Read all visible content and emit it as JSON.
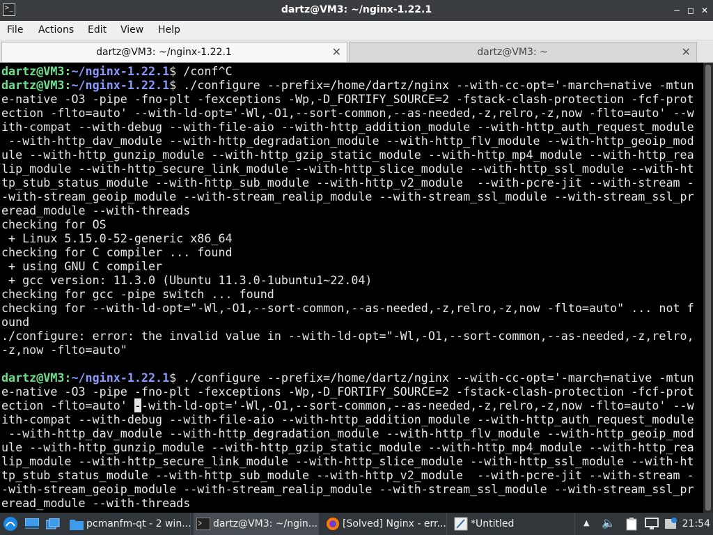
{
  "window": {
    "title": "dartz@VM3: ~/nginx-1.22.1",
    "controls": {
      "minimize": "−",
      "maximize": "◻",
      "close": "✕"
    }
  },
  "menu": [
    "File",
    "Actions",
    "Edit",
    "View",
    "Help"
  ],
  "tabs": [
    {
      "label": "dartz@VM3: ~/nginx-1.22.1",
      "active": true,
      "close": "✕"
    },
    {
      "label": "dartz@VM3: ~",
      "active": false,
      "close": "✕"
    }
  ],
  "terminal": {
    "prompt_user": "dartz@VM3",
    "prompt_path": "~/nginx-1.22.1",
    "lines": [
      {
        "type": "prompt",
        "text": " /conf^C"
      },
      {
        "type": "prompt",
        "text": " ./configure --prefix=/home/dartz/nginx --with-cc-opt='-march=native -mtun"
      },
      {
        "type": "text",
        "text": "e-native -O3 -pipe -fno-plt -fexceptions -Wp,-D_FORTIFY_SOURCE=2 -fstack-clash-protection -fcf-prot"
      },
      {
        "type": "text",
        "text": "ection -flto=auto' --with-ld-opt='-Wl,-O1,--sort-common,--as-needed,-z,relro,-z,now -flto=auto' --w"
      },
      {
        "type": "text",
        "text": "ith-compat --with-debug --with-file-aio --with-http_addition_module --with-http_auth_request_module"
      },
      {
        "type": "text",
        "text": " --with-http_dav_module --with-http_degradation_module --with-http_flv_module --with-http_geoip_mod"
      },
      {
        "type": "text",
        "text": "ule --with-http_gunzip_module --with-http_gzip_static_module --with-http_mp4_module --with-http_rea"
      },
      {
        "type": "text",
        "text": "lip_module --with-http_secure_link_module --with-http_slice_module --with-http_ssl_module --with-ht"
      },
      {
        "type": "text",
        "text": "tp_stub_status_module --with-http_sub_module --with-http_v2_module  --with-pcre-jit --with-stream -"
      },
      {
        "type": "text",
        "text": "-with-stream_geoip_module --with-stream_realip_module --with-stream_ssl_module --with-stream_ssl_pr"
      },
      {
        "type": "text",
        "text": "eread_module --with-threads"
      },
      {
        "type": "text",
        "text": "checking for OS"
      },
      {
        "type": "text",
        "text": " + Linux 5.15.0-52-generic x86_64"
      },
      {
        "type": "text",
        "text": "checking for C compiler ... found"
      },
      {
        "type": "text",
        "text": " + using GNU C compiler"
      },
      {
        "type": "text",
        "text": " + gcc version: 11.3.0 (Ubuntu 11.3.0-1ubuntu1~22.04)"
      },
      {
        "type": "text",
        "text": "checking for gcc -pipe switch ... found"
      },
      {
        "type": "text",
        "text": "checking for --with-ld-opt=\"-Wl,-O1,--sort-common,--as-needed,-z,relro,-z,now -flto=auto\" ... not f"
      },
      {
        "type": "text",
        "text": "ound"
      },
      {
        "type": "text",
        "text": "./configure: error: the invalid value in --with-ld-opt=\"-Wl,-O1,--sort-common,--as-needed,-z,relro,"
      },
      {
        "type": "text",
        "text": "-z,now -flto=auto\""
      },
      {
        "type": "text",
        "text": ""
      },
      {
        "type": "prompt",
        "text": " ./configure --prefix=/home/dartz/nginx --with-cc-opt='-march=native -mtun"
      },
      {
        "type": "text",
        "text": "e-native -O3 -pipe -fno-plt -fexceptions -Wp,-D_FORTIFY_SOURCE=2 -fstack-clash-protection -fcf-prot"
      },
      {
        "type": "cursor",
        "before": "ection -flto=auto' ",
        "cursor": "-",
        "after": "-with-ld-opt='-Wl,-O1,--sort-common,--as-needed,-z,relro,-z,now -flto=auto' --w"
      },
      {
        "type": "text",
        "text": "ith-compat --with-debug --with-file-aio --with-http_addition_module --with-http_auth_request_module"
      },
      {
        "type": "text",
        "text": " --with-http_dav_module --with-http_degradation_module --with-http_flv_module --with-http_geoip_mod"
      },
      {
        "type": "text",
        "text": "ule --with-http_gunzip_module --with-http_gzip_static_module --with-http_mp4_module --with-http_rea"
      },
      {
        "type": "text",
        "text": "lip_module --with-http_secure_link_module --with-http_slice_module --with-http_ssl_module --with-ht"
      },
      {
        "type": "text",
        "text": "tp_stub_status_module --with-http_sub_module --with-http_v2_module  --with-pcre-jit --with-stream -"
      },
      {
        "type": "text",
        "text": "-with-stream_geoip_module --with-stream_realip_module --with-stream_ssl_module --with-stream_ssl_pr"
      },
      {
        "type": "text",
        "text": "eread_module --with-threads"
      }
    ]
  },
  "taskbar": {
    "tasks": [
      {
        "label": "pcmanfm-qt - 2 win...",
        "icon": "folder-icon"
      },
      {
        "label": "dartz@VM3: ~/ngin...",
        "icon": "terminal-icon",
        "active": true
      },
      {
        "label": "[Solved] Nginx - err...",
        "icon": "firefox-icon"
      },
      {
        "label": "*Untitled",
        "icon": "text-editor-icon"
      }
    ],
    "clock": "21:54"
  }
}
